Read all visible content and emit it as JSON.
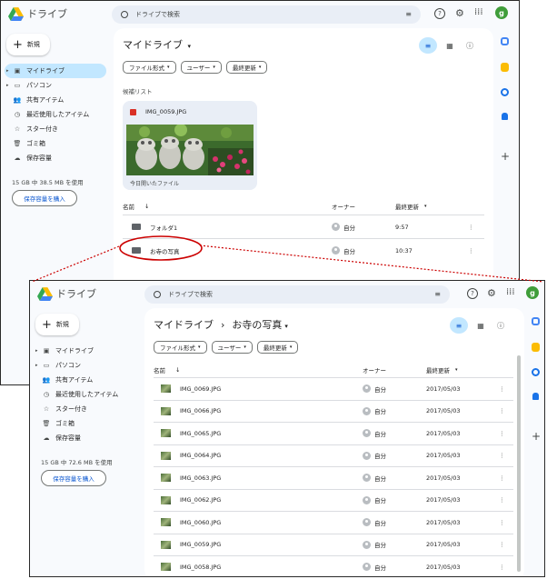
{
  "app": {
    "name": "ドライブ",
    "search_placeholder": "ドライブで検索",
    "user_initial": "g",
    "new_label": "新規"
  },
  "nav": {
    "items": [
      {
        "label": "マイドライブ",
        "icon": "my-drive-icon"
      },
      {
        "label": "パソコン",
        "icon": "computer-icon"
      },
      {
        "label": "共有アイテム",
        "icon": "shared-icon"
      },
      {
        "label": "最近使用したアイテム",
        "icon": "clock-icon"
      },
      {
        "label": "スター付き",
        "icon": "star-icon"
      },
      {
        "label": "ゴミ箱",
        "icon": "trash-icon"
      },
      {
        "label": "保存容量",
        "icon": "cloud-icon"
      }
    ],
    "buy_storage": "保存容量を購入"
  },
  "filters": [
    "ファイル形式",
    "ユーザー",
    "最終更新"
  ],
  "columns": {
    "name": "名前",
    "owner": "オーナー",
    "modified": "最終更新"
  },
  "screen1": {
    "title": "マイドライブ",
    "storage": "15 GB 中 38.5 MB を使用",
    "suggested_label": "候補リスト",
    "card": {
      "filename": "IMG_0059.JPG",
      "subtitle": "今日開いたファイル"
    },
    "rows": [
      {
        "name": "フォルダ1",
        "owner": "自分",
        "modified": "9:57"
      },
      {
        "name": "お寺の写真",
        "owner": "自分",
        "modified": "10:37"
      }
    ]
  },
  "screen2": {
    "breadcrumb_root": "マイドライブ",
    "breadcrumb_sep": "›",
    "breadcrumb_current": "お寺の写真",
    "storage": "15 GB 中 72.6 MB を使用",
    "rows": [
      {
        "name": "IMG_0069.JPG",
        "owner": "自分",
        "modified": "2017/05/03"
      },
      {
        "name": "IMG_0066.JPG",
        "owner": "自分",
        "modified": "2017/05/03"
      },
      {
        "name": "IMG_0065.JPG",
        "owner": "自分",
        "modified": "2017/05/03"
      },
      {
        "name": "IMG_0064.JPG",
        "owner": "自分",
        "modified": "2017/05/03"
      },
      {
        "name": "IMG_0063.JPG",
        "owner": "自分",
        "modified": "2017/05/03"
      },
      {
        "name": "IMG_0062.JPG",
        "owner": "自分",
        "modified": "2017/05/03"
      },
      {
        "name": "IMG_0060.JPG",
        "owner": "自分",
        "modified": "2017/05/03"
      },
      {
        "name": "IMG_0059.JPG",
        "owner": "自分",
        "modified": "2017/05/03"
      },
      {
        "name": "IMG_0058.JPG",
        "owner": "自分",
        "modified": "2017/05/03"
      }
    ]
  },
  "colors": {
    "accent": "#0b57d0",
    "active_nav": "#c2e7ff",
    "callout": "#cc0000",
    "avatar": "#3f9d3a"
  }
}
